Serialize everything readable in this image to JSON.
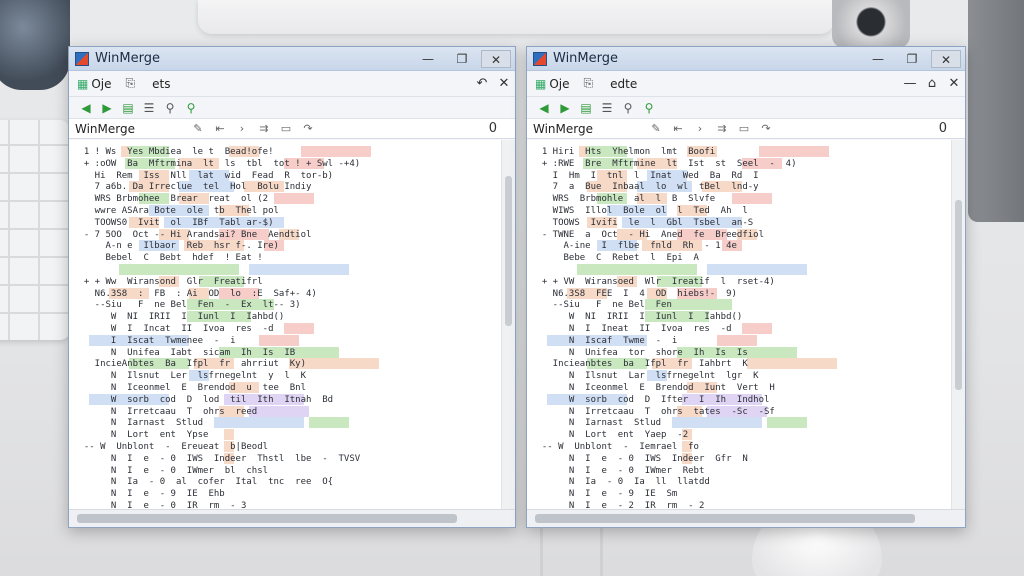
{
  "windows": [
    {
      "id": "left",
      "title": "WinMerge",
      "menu": [
        "Oje",
        "ets",
        "els"
      ],
      "path_label": "WinMerge",
      "diff_count": "0",
      "lines": [
        "  1 ! Ws  Yes Mbdiea  le t  Bead!ofe!",
        "  + :oOW  Ba  Mftrmina  lt  ls  tbl  tot ! + Swl -+4)",
        "    Hi  Rem  Iss  Nll  lat  wid  Fead  R  tor-b)",
        "    7 a6b. Da Irreclue  tel  Hol  Bolu Indiy",
        "    WRS Brbmohee  Brear  reat  ol (2",
        "    wwre ASAra Bote  ole  tb  Thel pol",
        "    TOOWS0  Ivit  ol  IBf  Tabl ar-$)",
        "  - 7 5OO  Oct -- Hi Arandsai? Bne  Aendtiol",
        "      A-n e  Ilbaor  Reb  hsr f-. Ire)",
        "      Bebel  C  Bebt  hdef  ! Eat !",
        "",
        "  + + Ww  Wiransond  Glr  Freatifrl",
        "    N6.3S8  :  FB  : Ai  OD  lo  :E  Saf+- 4)",
        "    --Siu   F  ne Bel  Fen  -  Ex  lt-- 3)",
        "       W  NI  IRII  I  Iunl  I  Iahbd()",
        "       W  I  Incat  II  Ivoa  res  -d",
        "       I  Iscat  Twmenee  -  i",
        "       N  Unifea  Iabt  sicam  Ih  Is  IB",
        "    IncieAnbtes  Ba  Ifpl  fr  ahrriut  Ky)",
        "       N  Ilsnut  Ler  lsfrnegelnt  y  l  K",
        "       N  Iceonmel  E  Brendod  u  tee  Bnl",
        "       W  sorb  cod  D  lod  til  Ith  Itnah  Bd",
        "       N  Irretcaau  T  ohrs  reed",
        "       N  Iarnast  Stlud",
        "       N  Lort  ent  Ypse",
        "  -- W  Unblont  -  Ereueat  b|Beodl",
        "       N  I  e  - 0  IWS  Indeer  Thstl  lbe  -  TVSV",
        "       N  I  e  - 0  IWmer  bl  chsl",
        "       N  Ia  - 0  al  cofer  Ital  tnc  ree  O{",
        "       N  I  e  - 9  IE  Ehb",
        "       N  I  e  - 0  IR  rm  - 3",
        "       N  Ia  - 0  IR  le  - 3e"
      ]
    },
    {
      "id": "right",
      "title": "WinMerge",
      "menu": [
        "Oje",
        "ets",
        "edte"
      ],
      "path_label": "WinMerge",
      "diff_count": "0",
      "lines": [
        "  1 Hiri  Hts  Yhelmon  lmt  Boofi",
        "  + :RWE  Bre  Mftrmine  lt  Ist  st  Seel  -  4)",
        "    I  Hm  I  tnl  l  Inat  Wed  Ba  Rd  I",
        "    7  a  Bue  Inbaal  lo  wl  tBel  lnd-y",
        "    WRS  Brbmohle  al  l  B  Slvfe",
        "    WIWS  Illol  Bole  ol  l  Ted  Ah  l",
        "    TOOWS  Ivifi  le  l  Gbl  Tsbel  an-S",
        "  - TWNE  a  Oct  - Hi  Aned  fe  Breedfiol",
        "      A-ine  I  flbe  fnld  Rh  - 1 4e",
        "      Bebe  C  Rebet  l  Epi  A",
        "",
        "  + + VW  Wiransoed  Wlr  Ireatif  l  rset-4)",
        "    N6.3S8  FEE  I  4  OD  hiebs!-  9)",
        "    --Siu   F  ne Bel  Fen",
        "       W  NI  IRII  I  Iunl  I  Iahbd()",
        "       N  I  Ineat  II  Ivoa  res  -d",
        "       N  Iscaf  Twme  -  i",
        "       N  Unifea  tor  shore  Ih  Is  Is",
        "    Incieanbtes  ba  Ifpl  fr  Iahbrt  K",
        "       N  Ilsnut  Lar  lsfrnegelnt  lgr  K",
        "       N  Iceonmel  E  Brendod  Iunt  Vert  H",
        "       W  sorb  cod  D  Ifter  I  Ih  Indhol",
        "       N  Irretcaau  T  ohrs  tates  -Sc  -Sf",
        "       N  Iarnast  Stlud",
        "       N  Lort  ent  Yaep  -2",
        "  -- W  Unblont  -  Iemrael  fo",
        "       N  I  e  - 0  IWS  Indeer  Gfr  N",
        "       N  I  e  - 0  IWmer  Rebt",
        "       N  Ia  - 0  Ia  ll  llatdd",
        "       N  I  e  - 9  IE  Sm",
        "       N  I  e  - 2  IR  rm  - 2",
        "       N  Ia  - 0  IR  le  - 2e"
      ]
    }
  ],
  "colors": {
    "add": "#bfe4b4",
    "change": "#f6d2bd",
    "moved": "#c9d9f3",
    "other": "#d9cdf1"
  }
}
